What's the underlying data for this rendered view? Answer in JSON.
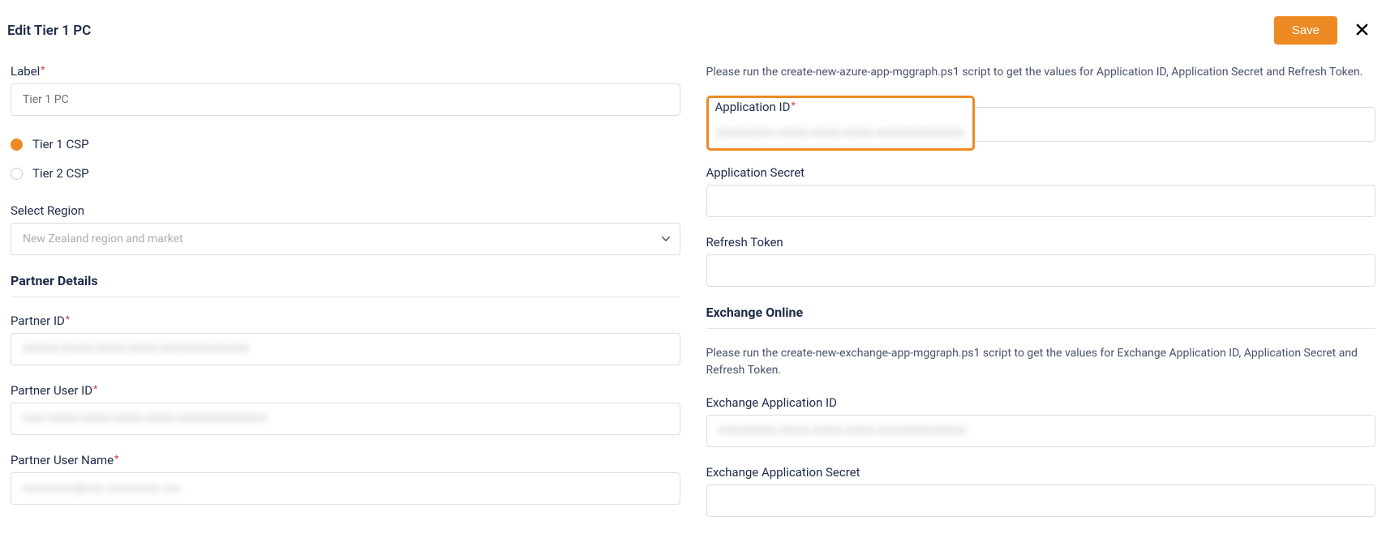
{
  "header": {
    "title": "Edit Tier 1 PC",
    "save_label": "Save"
  },
  "left": {
    "label_field": {
      "label": "Label",
      "value": "Tier 1 PC"
    },
    "tier_options": [
      {
        "label": "Tier 1 CSP",
        "selected": true
      },
      {
        "label": "Tier 2 CSP",
        "selected": false
      }
    ],
    "region": {
      "label": "Select Region",
      "placeholder": "New Zealand region and market"
    },
    "partner_details_heading": "Partner Details",
    "partner_id": {
      "label": "Partner ID",
      "masked": "XXXXX-XXXX-XXXX-XXXX-XXXXXXXXXXXX"
    },
    "partner_user_id": {
      "label": "Partner User ID",
      "masked": "XXX-XXXX-XXXX-XXXX-XXXX-XXXXXXXXXXXX"
    },
    "partner_user_name": {
      "label": "Partner User Name",
      "masked": "xxxxxxxxx@xxx.xxxxxxxxx.xxx"
    }
  },
  "right": {
    "helper1": "Please run the create-new-azure-app-mggraph.ps1 script to get the values for Application ID, Application Secret and Refresh Token.",
    "app_id": {
      "label": "Application ID",
      "masked": "XXXXXXXX-XXXX-XXXX-XXXX-XXXXXXXXXXXX"
    },
    "app_secret": {
      "label": "Application Secret",
      "value": ""
    },
    "refresh_token": {
      "label": "Refresh Token",
      "value": ""
    },
    "exchange_heading": "Exchange Online",
    "helper2": "Please run the create-new-exchange-app-mggraph.ps1 script to get the values for Exchange Application ID, Application Secret and Refresh Token.",
    "exchange_app_id": {
      "label": "Exchange Application ID",
      "masked": "XXXXXXXX-XXXX-XXXX-XXXX-XXXXXXXXXXXX"
    },
    "exchange_app_secret": {
      "label": "Exchange Application Secret",
      "value": ""
    }
  }
}
